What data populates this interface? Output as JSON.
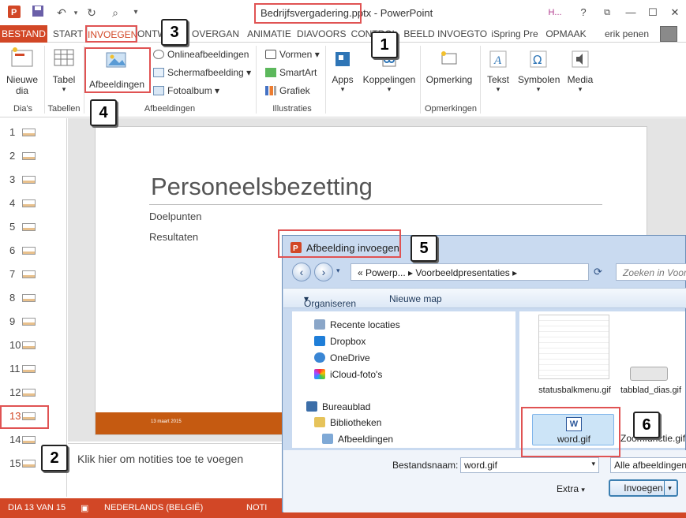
{
  "window": {
    "title": "Bedrijfsvergadering.pptx - PowerPoint",
    "account_initial": "H...",
    "help": "?",
    "user": "erik penen"
  },
  "tabs": [
    "BESTAND",
    "START",
    "INVOEGEN",
    "ONTWERPEN",
    "OVERGAN",
    "ANIMATIE",
    "DIAVOORS",
    "CONTROL",
    "BEELD",
    "INVOEGTO",
    "iSpring Pre",
    "OPMAAK"
  ],
  "ribbon": {
    "new_slide": "Nieuwe dia",
    "new_slide_arrow": "▾",
    "table": "Tabel",
    "pictures": "Afbeeldingen",
    "online_pictures": "Onlineafbeeldingen",
    "screenshot": "Schermafbeelding",
    "photo_album": "Fotoalbum",
    "shapes": "Vormen",
    "smartart": "SmartArt",
    "chart": "Grafiek",
    "apps": "Apps",
    "links": "Koppelingen",
    "comment": "Opmerking",
    "text": "Tekst",
    "symbols": "Symbolen",
    "media": "Media",
    "groups": {
      "slides": "Dia's",
      "tables": "Tabellen",
      "images": "Afbeeldingen",
      "illustrations": "Illustraties",
      "comments": "Opmerkingen"
    }
  },
  "thumbnails": [
    {
      "num": "1"
    },
    {
      "num": "2"
    },
    {
      "num": "3"
    },
    {
      "num": "4"
    },
    {
      "num": "5"
    },
    {
      "num": "6"
    },
    {
      "num": "7"
    },
    {
      "num": "8"
    },
    {
      "num": "9"
    },
    {
      "num": "10"
    },
    {
      "num": "11"
    },
    {
      "num": "12"
    },
    {
      "num": "13"
    },
    {
      "num": "14"
    },
    {
      "num": "15"
    }
  ],
  "slide": {
    "title": "Personeelsbezetting",
    "bullets": [
      "Doelpunten",
      "Resultaten"
    ],
    "date": "13 maart 2015"
  },
  "notes_placeholder": "Klik hier om notities toe te voegen",
  "status": {
    "slide_of": "DIA 13 VAN 15",
    "language": "NEDERLANDS (BELGIË)",
    "notes": "NOTI"
  },
  "dialog": {
    "title": "Afbeelding invoegen",
    "path": "«  Powerp...  ▸  Voorbeeldpresentaties  ▸",
    "search_placeholder": "Zoeken in Voorb",
    "organize": "Organiseren",
    "new_folder": "Nieuwe map",
    "nav_items": [
      "Recente locaties",
      "Dropbox",
      "OneDrive",
      "iCloud-foto's"
    ],
    "desktop": "Bureaublad",
    "libraries": "Bibliotheken",
    "pictures_lib": "Afbeeldingen",
    "files": [
      {
        "name": "statusbalkmenu.gif"
      },
      {
        "name": "tabblad_dias.gif"
      },
      {
        "name": "word.gif"
      },
      {
        "name": "Zoomfunctie.gif"
      }
    ],
    "filename_label": "Bestandsnaam:",
    "filename_value": "word.gif",
    "filter": "Alle afbeeldingen",
    "extra": "Extra",
    "insert": "Invoegen"
  },
  "callouts": [
    "1",
    "2",
    "3",
    "4",
    "5",
    "6"
  ],
  "colors": {
    "accent": "#d24726",
    "highlight": "#e05353"
  }
}
